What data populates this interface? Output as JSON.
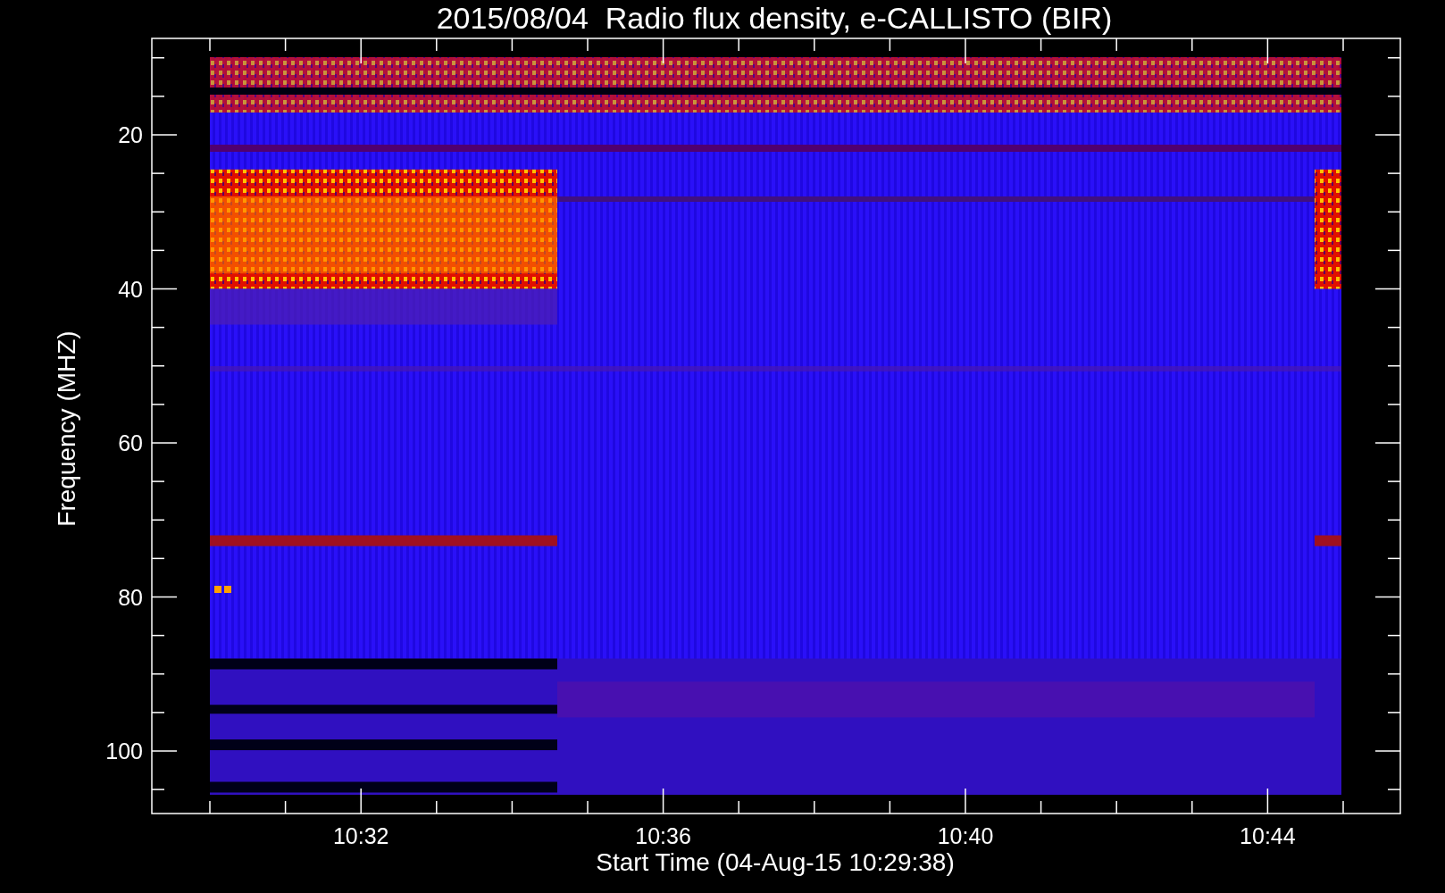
{
  "title": "2015/08/04  Radio flux density, e-CALLISTO (BIR)",
  "ylabel": "Frequency (MHZ)",
  "yticks": [
    "20",
    "40",
    "60",
    "80",
    "100"
  ],
  "xticks": [
    "10:32",
    "10:36",
    "10:40",
    "10:44"
  ],
  "xlabel": "Start Time (04-Aug-15 10:29:38)"
}
